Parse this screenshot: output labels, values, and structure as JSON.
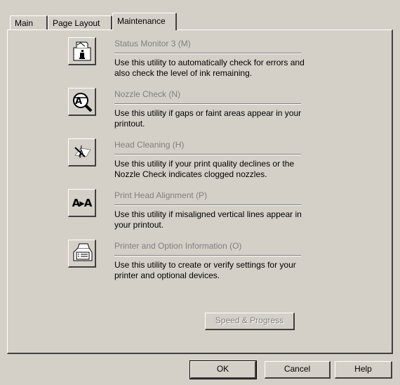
{
  "tabs": [
    {
      "label": "Main"
    },
    {
      "label": "Page Layout"
    },
    {
      "label": "Maintenance",
      "active": true
    }
  ],
  "utilities": [
    {
      "icon": "status-monitor-icon",
      "title": "Status Monitor 3 (M)",
      "description": "Use this utility to automatically check for errors and also check the level of ink remaining."
    },
    {
      "icon": "nozzle-check-icon",
      "title": "Nozzle Check (N)",
      "description": "Use this utility if gaps or faint areas appear in your printout."
    },
    {
      "icon": "head-cleaning-icon",
      "title": "Head Cleaning (H)",
      "description": "Use this utility if your print quality declines or the Nozzle Check indicates clogged nozzles."
    },
    {
      "icon": "head-alignment-icon",
      "title": "Print Head Alignment (P)",
      "description": "Use this utility if misaligned vertical lines appear in your printout.",
      "icon_text": "A▸A"
    },
    {
      "icon": "printer-info-icon",
      "title": "Printer and Option Information (O)",
      "description": "Use this utility to create or verify settings for your printer and optional devices."
    }
  ],
  "speed_button": {
    "label": "Speed & Progress",
    "disabled": true
  },
  "footer": {
    "ok_label": "OK",
    "cancel_label": "Cancel",
    "help_label": "Help"
  }
}
